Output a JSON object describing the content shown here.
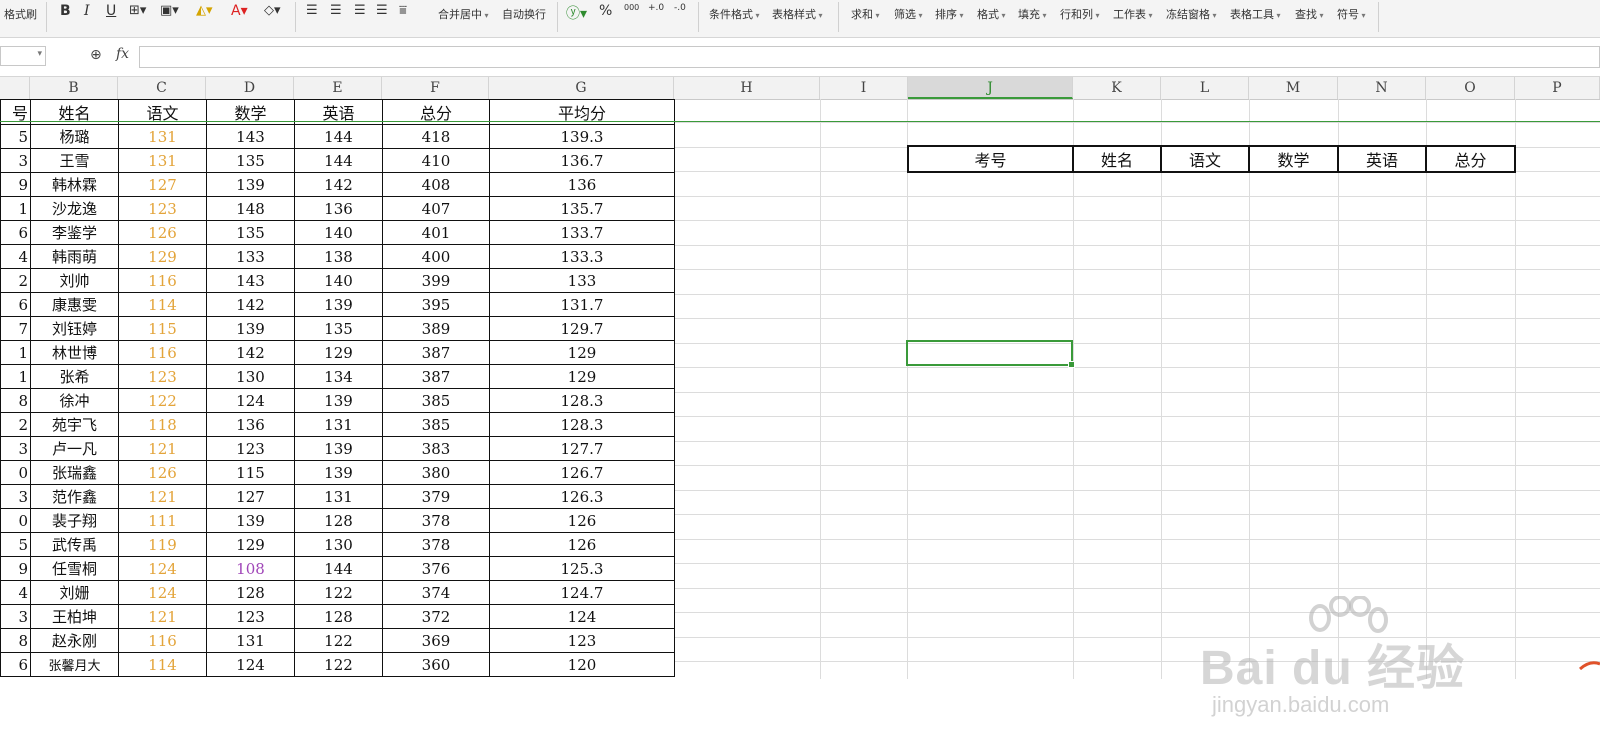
{
  "ribbon": {
    "format_painter": "格式刷",
    "merge_center": "合并居中",
    "wrap_text": "自动换行",
    "conditional_format": "条件格式",
    "table_style": "表格样式",
    "sum": "求和",
    "filter": "筛选",
    "sort": "排序",
    "format": "格式",
    "fill": "填充",
    "rows_cols": "行和列",
    "worksheet": "工作表",
    "freeze": "冻结窗格",
    "table_tools": "表格工具",
    "find": "查找",
    "symbol": "符号",
    "percent_glyph": "%",
    "thousands_glyph": "000",
    "inc_decimal_glyph": "+.0",
    "dec_decimal_glyph": "-.0"
  },
  "formula_bar": {
    "fx_label": "fx",
    "value": ""
  },
  "columns": [
    "B",
    "C",
    "D",
    "E",
    "F",
    "G",
    "H",
    "I",
    "J",
    "K",
    "L",
    "M",
    "N",
    "O",
    "P"
  ],
  "active_column": "J",
  "data_table": {
    "headers": [
      "",
      "姓名",
      "语文",
      "数学",
      "英语",
      "总分",
      "平均分"
    ],
    "first_header_fragment": "号",
    "rows": [
      {
        "id": "5",
        "name": "杨璐",
        "chinese": "131",
        "math": "143",
        "english": "144",
        "total": "418",
        "avg": "139.3"
      },
      {
        "id": "3",
        "name": "王雪",
        "chinese": "131",
        "math": "135",
        "english": "144",
        "total": "410",
        "avg": "136.7"
      },
      {
        "id": "9",
        "name": "韩林霖",
        "chinese": "127",
        "math": "139",
        "english": "142",
        "total": "408",
        "avg": "136"
      },
      {
        "id": "1",
        "name": "沙龙逸",
        "chinese": "123",
        "math": "148",
        "english": "136",
        "total": "407",
        "avg": "135.7"
      },
      {
        "id": "6",
        "name": "李鉴学",
        "chinese": "126",
        "math": "135",
        "english": "140",
        "total": "401",
        "avg": "133.7"
      },
      {
        "id": "4",
        "name": "韩雨萌",
        "chinese": "129",
        "math": "133",
        "english": "138",
        "total": "400",
        "avg": "133.3"
      },
      {
        "id": "2",
        "name": "刘帅",
        "chinese": "116",
        "math": "143",
        "english": "140",
        "total": "399",
        "avg": "133"
      },
      {
        "id": "6",
        "name": "康惠雯",
        "chinese": "114",
        "math": "142",
        "english": "139",
        "total": "395",
        "avg": "131.7"
      },
      {
        "id": "7",
        "name": "刘钰婷",
        "chinese": "115",
        "math": "139",
        "english": "135",
        "total": "389",
        "avg": "129.7"
      },
      {
        "id": "1",
        "name": "林世博",
        "chinese": "116",
        "math": "142",
        "english": "129",
        "total": "387",
        "avg": "129"
      },
      {
        "id": "1",
        "name": "张希",
        "chinese": "123",
        "math": "130",
        "english": "134",
        "total": "387",
        "avg": "129"
      },
      {
        "id": "8",
        "name": "徐冲",
        "chinese": "122",
        "math": "124",
        "english": "139",
        "total": "385",
        "avg": "128.3"
      },
      {
        "id": "2",
        "name": "苑宇飞",
        "chinese": "118",
        "math": "136",
        "english": "131",
        "total": "385",
        "avg": "128.3"
      },
      {
        "id": "3",
        "name": "卢一凡",
        "chinese": "121",
        "math": "123",
        "english": "139",
        "total": "383",
        "avg": "127.7"
      },
      {
        "id": "0",
        "name": "张瑞鑫",
        "chinese": "126",
        "math": "115",
        "english": "139",
        "total": "380",
        "avg": "126.7"
      },
      {
        "id": "3",
        "name": "范作鑫",
        "chinese": "121",
        "math": "127",
        "english": "131",
        "total": "379",
        "avg": "126.3"
      },
      {
        "id": "0",
        "name": "裴子翔",
        "chinese": "111",
        "math": "139",
        "english": "128",
        "total": "378",
        "avg": "126"
      },
      {
        "id": "5",
        "name": "武传禹",
        "chinese": "119",
        "math": "129",
        "english": "130",
        "total": "378",
        "avg": "126"
      },
      {
        "id": "9",
        "name": "任雪桐",
        "chinese": "124",
        "math": "108",
        "english": "144",
        "total": "376",
        "avg": "125.3"
      },
      {
        "id": "4",
        "name": "刘姗",
        "chinese": "124",
        "math": "128",
        "english": "122",
        "total": "374",
        "avg": "124.7"
      },
      {
        "id": "3",
        "name": "王柏坤",
        "chinese": "121",
        "math": "123",
        "english": "128",
        "total": "372",
        "avg": "124"
      },
      {
        "id": "8",
        "name": "赵永刚",
        "chinese": "116",
        "math": "131",
        "english": "122",
        "total": "369",
        "avg": "123"
      },
      {
        "id": "6",
        "name": "张馨月大",
        "chinese": "114",
        "math": "124",
        "english": "122",
        "total": "360",
        "avg": "120"
      }
    ]
  },
  "lookup_table": {
    "headers": [
      "考号",
      "姓名",
      "语文",
      "数学",
      "英语",
      "总分"
    ]
  },
  "watermark": {
    "brand": "Bai du 经验",
    "url": "jingyan.baidu.com"
  },
  "colors": {
    "accent_green": "#3a9a3a",
    "chinese_score": "#e3a43a",
    "math_low": "#a046b8"
  }
}
